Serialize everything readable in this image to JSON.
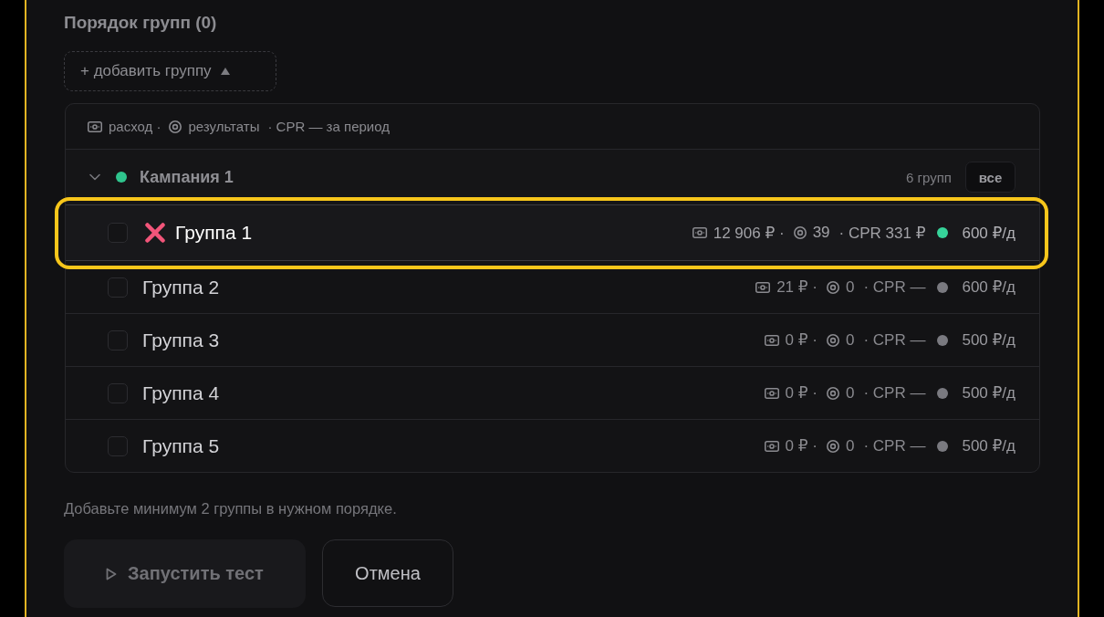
{
  "title": "Порядок групп (0)",
  "add_button": {
    "label": "+ добавить группу"
  },
  "legend": {
    "spend": "расход ·",
    "results": "результаты",
    "cpr": "· CPR — за период"
  },
  "campaigns": [
    {
      "name": "Кампания 1",
      "color": "#2fc48d",
      "expanded": true,
      "count": "6 групп",
      "all_button": "все",
      "groups": [
        {
          "name": "Группа 1",
          "checked": false,
          "highlighted": true,
          "cross_mark": true,
          "spend": "12 906 ₽ ·",
          "results": "39",
          "cpr": "· CPR 331 ₽",
          "color": "#36d39a",
          "budget": "600 ₽/д"
        },
        {
          "name": "Группа 2",
          "checked": false,
          "highlighted": false,
          "cross_mark": false,
          "spend": "21 ₽ ·",
          "results": "0",
          "cpr": "· CPR —",
          "color": "#7a7a80",
          "budget": "600 ₽/д"
        },
        {
          "name": "Группа 3",
          "checked": false,
          "highlighted": false,
          "cross_mark": false,
          "spend": "0 ₽ ·",
          "results": "0",
          "cpr": "· CPR —",
          "color": "#7a7a80",
          "budget": "500 ₽/д"
        },
        {
          "name": "Группа 4",
          "checked": false,
          "highlighted": false,
          "cross_mark": false,
          "spend": "0 ₽ ·",
          "results": "0",
          "cpr": "· CPR —",
          "color": "#7a7a80",
          "budget": "500 ₽/д"
        },
        {
          "name": "Группа 5",
          "checked": false,
          "highlighted": false,
          "cross_mark": false,
          "spend": "0 ₽ ·",
          "results": "0",
          "cpr": "· CPR —",
          "color": "#7a7a80",
          "budget": "500 ₽/д"
        }
      ]
    }
  ],
  "hint": "Добавьте минимум 2 группы в нужном порядке.",
  "buttons": [
    {
      "label": "Запустить тест",
      "kind": "primary",
      "disabled": true
    },
    {
      "label": "Отмена",
      "kind": "secondary",
      "disabled": false
    }
  ]
}
